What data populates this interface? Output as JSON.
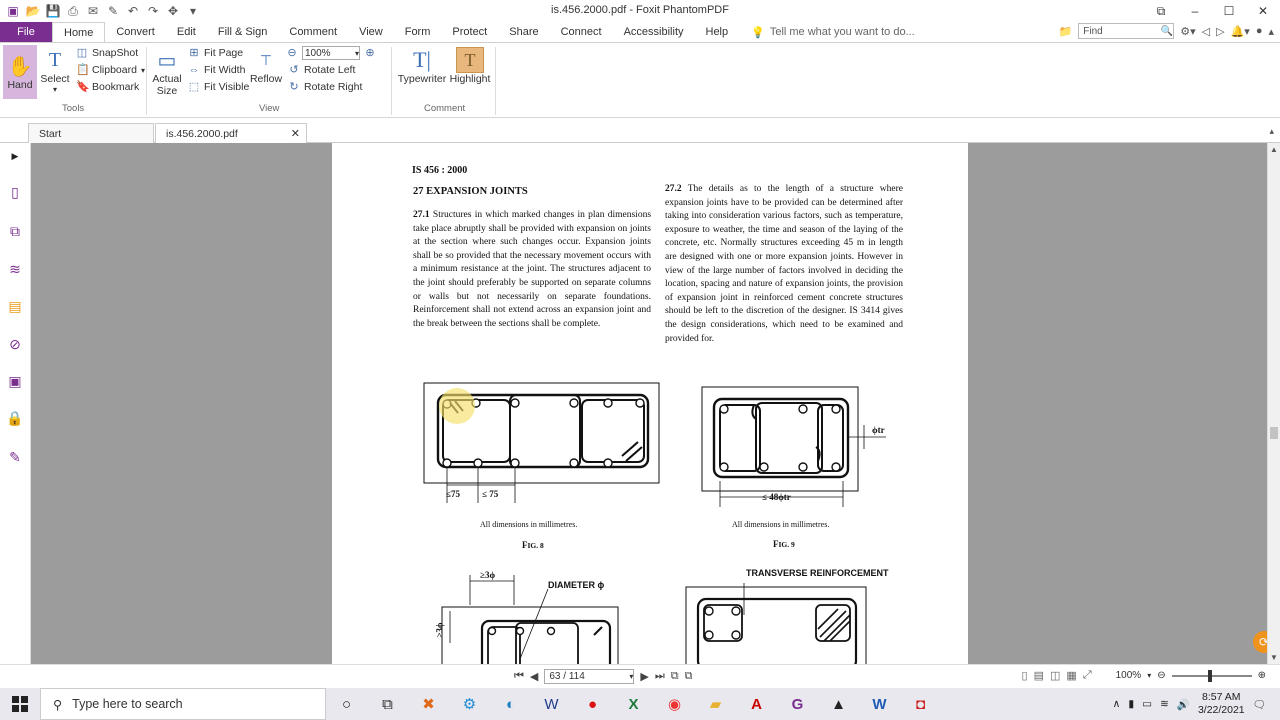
{
  "window": {
    "title": "is.456.2000.pdf - Foxit PhantomPDF",
    "controls": [
      "restore-icon",
      "minimize-icon",
      "maximize-icon",
      "close-icon"
    ]
  },
  "menu": {
    "file": "File",
    "tabs": [
      "Home",
      "Convert",
      "Edit",
      "Fill & Sign",
      "Comment",
      "View",
      "Form",
      "Protect",
      "Share",
      "Connect",
      "Accessibility",
      "Help"
    ],
    "active_tab": "Home",
    "tell_me": "Tell me what you want to do...",
    "find_placeholder": "Find"
  },
  "ribbon": {
    "hand": "Hand",
    "select": "Select",
    "snapshot": "SnapShot",
    "clipboard": "Clipboard",
    "bookmark": "Bookmark",
    "tools_group": "Tools",
    "actual_size": "Actual Size",
    "actual_size_l1": "Actual",
    "actual_size_l2": "Size",
    "fit_page": "Fit Page",
    "fit_width": "Fit Width",
    "fit_visible": "Fit Visible",
    "reflow": "Reflow",
    "zoom": "100%",
    "rotate_left": "Rotate Left",
    "rotate_right": "Rotate Right",
    "view_group": "View",
    "typewriter": "Typewriter",
    "highlight": "Highlight",
    "comment_group": "Comment"
  },
  "doc_tabs": [
    {
      "label": "Start",
      "active": false
    },
    {
      "label": "is.456.2000.pdf",
      "active": true
    }
  ],
  "document": {
    "header": "IS 456 : 2000",
    "section_title": "27  EXPANSION JOINTS",
    "p27_1_num": "27.1",
    "p27_1": "Structures in which marked changes in plan dimensions take place abruptly shall be provided with expansion on joints at the section where such changes occur.  Expansion joints shall be so provided that the necessary movement occurs with a minimum resistance at the joint.  The structures adjacent to the joint should preferably be supported on separate columns or walls but not necessarily on separate foundations.  Reinforcement shall not extend across an expansion joint and the break between the sections shall be complete.",
    "p27_2_num": "27.2",
    "p27_2": "The details as to the length of a structure where expansion joints have to be provided can be determined after taking into consideration various factors, such as temperature, exposure to weather, the time and season of the laying of the concrete, etc.  Normally structures exceeding 45 m in length are designed with one or more expansion joints.  However in view of the large number of factors involved in deciding the location, spacing and nature of expansion joints, the provision of expansion joint in reinforced cement concrete structures should be left to the discretion of the designer.  IS 3414 gives the design considerations, which need to be examined and provided for.",
    "fig8_dim1": "≤75",
    "fig8_dim2": "≤ 75",
    "fig8_note": "All dimensions in millimetres.",
    "fig8_cap_f": "F",
    "fig8_cap_rest": "IG. 8",
    "fig9_dim": "≤ 48ϕtr",
    "fig9_phi": "ϕtr",
    "fig9_note": "All dimensions in millimetres.",
    "fig9_cap_f": "F",
    "fig9_cap_rest": "IG. 9",
    "fig10_dim": "≥3ϕ",
    "fig10_dim_v": "≥3ϕ",
    "fig10_label": "DIAMETER ϕ",
    "fig11_label": "TRANSVERSE REINFORCEMENT"
  },
  "navigation": {
    "page": "63 / 114",
    "zoom": "100%"
  },
  "taskbar": {
    "search_placeholder": "Type here to search",
    "time": "8:57 AM",
    "date": "3/22/2021"
  },
  "colors": {
    "brand": "#7a2e8f",
    "doc_background": "#9c9c9c",
    "highlight_cursor": "#f5e06a"
  }
}
